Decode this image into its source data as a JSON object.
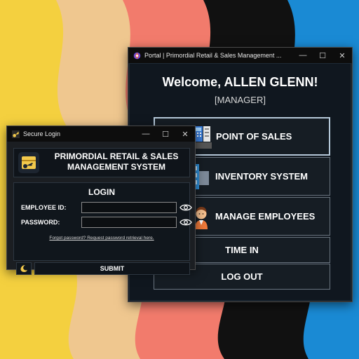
{
  "colors": {
    "wall_yellow": "#f4d03f",
    "wall_beige": "#efc78f",
    "wall_coral": "#f27b6c",
    "wall_black": "#111111",
    "wall_blue": "#1a8ad4",
    "window_bg": "#10171f",
    "accent_border": "#b5c8d9"
  },
  "portal": {
    "title": "Portal | Primordial Retail & Sales Management ...",
    "welcome": "Welcome, ALLEN GLENN!",
    "role": "[MANAGER]",
    "menu": [
      {
        "label": "POINT OF SALES",
        "icon": "cash-register-icon"
      },
      {
        "label": "INVENTORY SYSTEM",
        "icon": "inventory-shelf-icon"
      },
      {
        "label": "MANAGE EMPLOYEES",
        "icon": "employee-avatar-icon"
      },
      {
        "label": "TIME IN",
        "icon": ""
      },
      {
        "label": "LOG OUT",
        "icon": ""
      }
    ],
    "controls": {
      "minimize": "—",
      "maximize": "☐",
      "close": "✕"
    }
  },
  "login": {
    "title": "Secure Login",
    "system_name": "PRIMORDIAL RETAIL & SALES MANAGEMENT SYSTEM",
    "heading": "LOGIN",
    "employee_id_label": "EMPLOYEE ID:",
    "employee_id_value": "",
    "password_label": "PASSWORD:",
    "password_value": "",
    "forgot_link": "Forgot password? Request password retrieval here.",
    "submit_label": "SUBMIT",
    "theme_icon": "moon-icon",
    "controls": {
      "minimize": "—",
      "maximize": "☐",
      "close": "✕"
    }
  }
}
